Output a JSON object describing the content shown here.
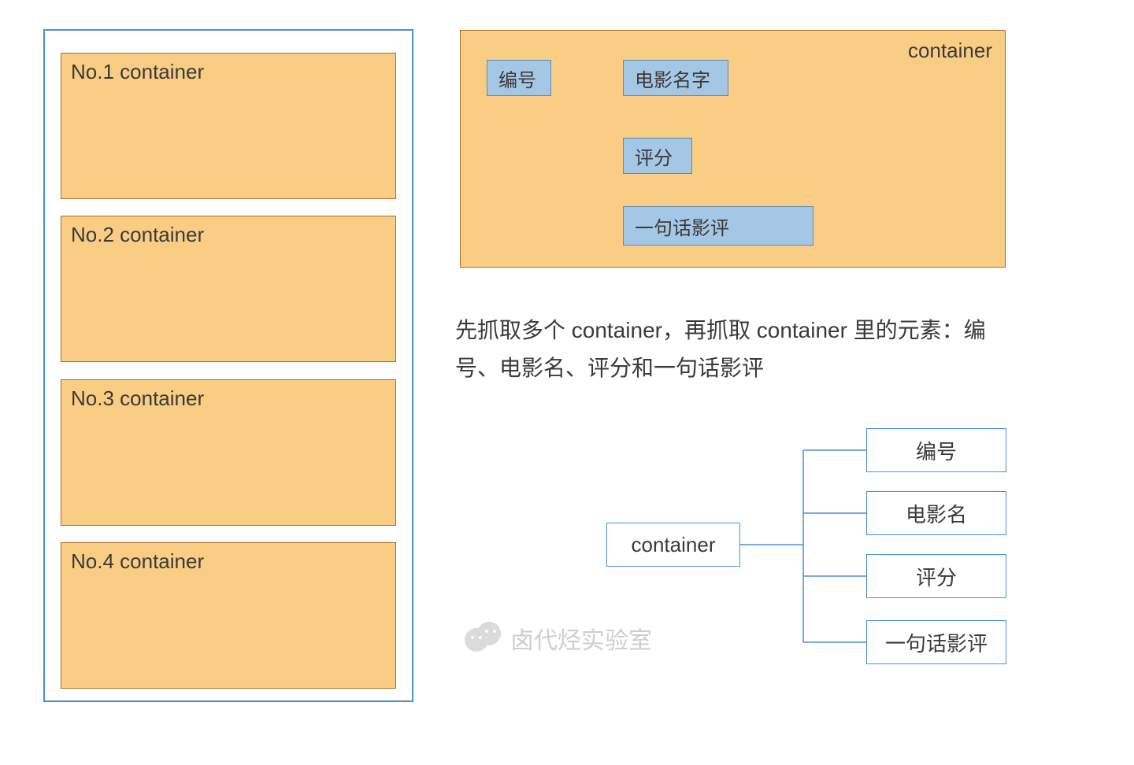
{
  "left": {
    "containers": [
      "No.1 container",
      "No.2 container",
      "No.3 container",
      "No.4 container"
    ]
  },
  "right_big": {
    "label": "container",
    "chips": {
      "id": "编号",
      "name": "电影名字",
      "rating": "评分",
      "review": "一句话影评"
    }
  },
  "description": "先抓取多个 container，再抓取 container 里的元素：编号、电影名、评分和一句话影评",
  "tree": {
    "root": "container",
    "children": [
      "编号",
      "电影名",
      "评分",
      "一句话影评"
    ]
  },
  "watermark": "卤代烃实验室"
}
